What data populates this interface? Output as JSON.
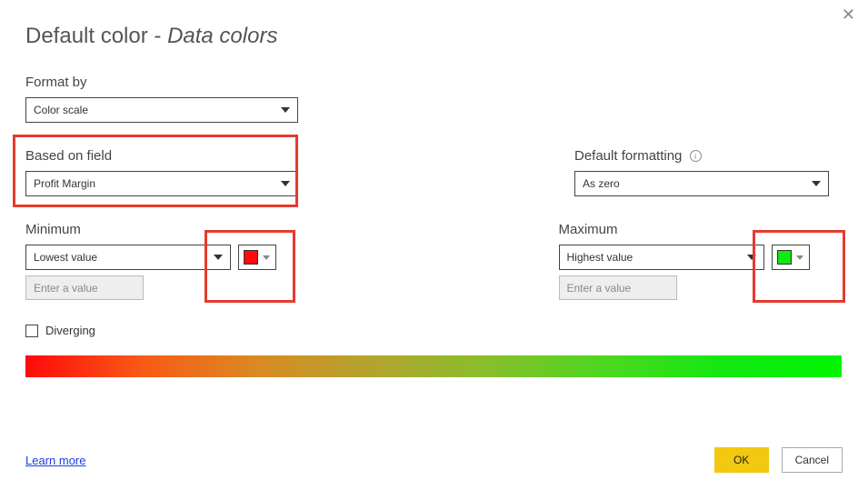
{
  "title_prefix": "Default color - ",
  "title_italic": "Data colors",
  "close_glyph": "✕",
  "format_by": {
    "label": "Format by",
    "value": "Color scale"
  },
  "based_on_field": {
    "label": "Based on field",
    "value": "Profit Margin"
  },
  "default_formatting": {
    "label": "Default formatting",
    "value": "As zero"
  },
  "minimum": {
    "label": "Minimum",
    "select_value": "Lowest value",
    "input_placeholder": "Enter a value",
    "color": "#ff0a0a"
  },
  "maximum": {
    "label": "Maximum",
    "select_value": "Highest value",
    "input_placeholder": "Enter a value",
    "color": "#12e812"
  },
  "diverging_label": "Diverging",
  "learn_more": "Learn more",
  "ok_label": "OK",
  "cancel_label": "Cancel",
  "info_glyph": "i",
  "chart_data": {
    "type": "area",
    "title": "Color scale gradient preview",
    "stops": [
      {
        "position": 0.0,
        "color": "#ff0a0a"
      },
      {
        "position": 1.0,
        "color": "#00f500"
      }
    ]
  }
}
